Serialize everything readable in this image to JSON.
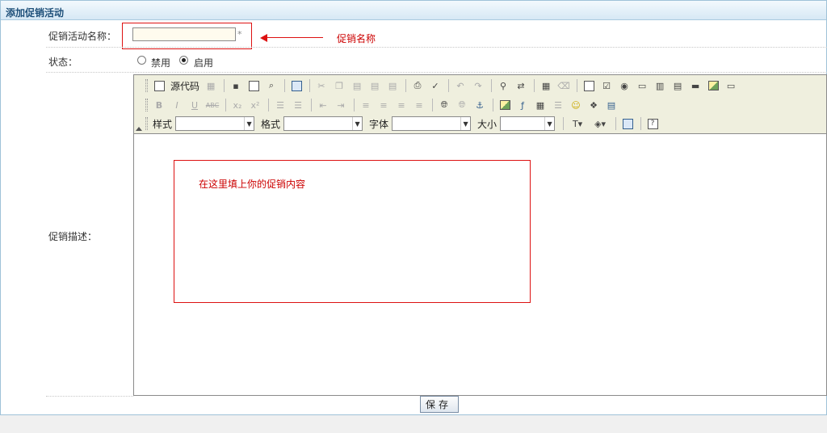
{
  "title": "添加促销活动",
  "form": {
    "name_label": "促销活动名称：",
    "name_value": "",
    "required_mark": "*",
    "status_label": "状态：",
    "status_options": [
      "禁用",
      "启用"
    ],
    "status_selected": "启用",
    "desc_label": "促销描述："
  },
  "annotations": {
    "name_hint": "促销名称",
    "content_hint": "在这里填上你的促销内容",
    "color": "#d11111"
  },
  "editor": {
    "source_label": "源代码",
    "style_label": "样式",
    "format_label": "格式",
    "font_label": "字体",
    "size_label": "大小",
    "style_value": "",
    "format_value": "",
    "font_value": "",
    "size_value": "",
    "content": "",
    "icons_row1": [
      "source-icon",
      "preview-template-icon",
      "save-icon",
      "new-page-icon",
      "preview-icon",
      "templates-icon",
      "cut-icon",
      "copy-icon",
      "paste-icon",
      "paste-text-icon",
      "paste-word-icon",
      "print-icon",
      "spellcheck-icon",
      "undo-icon",
      "redo-icon",
      "find-icon",
      "replace-icon",
      "select-all-icon",
      "remove-format-icon",
      "form-icon",
      "checkbox-icon",
      "radio-icon",
      "textfield-icon",
      "textarea-icon",
      "select-icon",
      "button-icon",
      "image-button-icon",
      "hidden-field-icon"
    ],
    "icons_row2": [
      "bold-icon",
      "italic-icon",
      "underline-icon",
      "strike-icon",
      "subscript-icon",
      "superscript-icon",
      "ordered-list-icon",
      "unordered-list-icon",
      "outdent-icon",
      "indent-icon",
      "align-left-icon",
      "align-center-icon",
      "align-right-icon",
      "justify-icon",
      "link-icon",
      "unlink-icon",
      "anchor-icon",
      "image-icon",
      "flash-icon",
      "table-icon",
      "horizontal-rule-icon",
      "smiley-icon",
      "special-char-icon",
      "page-break-icon"
    ],
    "icons_row3": [
      "text-color-icon",
      "bg-color-icon",
      "show-blocks-icon",
      "about-icon"
    ]
  },
  "buttons": {
    "save": "保存"
  },
  "colors": {
    "title_bar": "#d6e8f5",
    "title_text": "#1d4f79",
    "toolbar_bg": "#efefde"
  }
}
